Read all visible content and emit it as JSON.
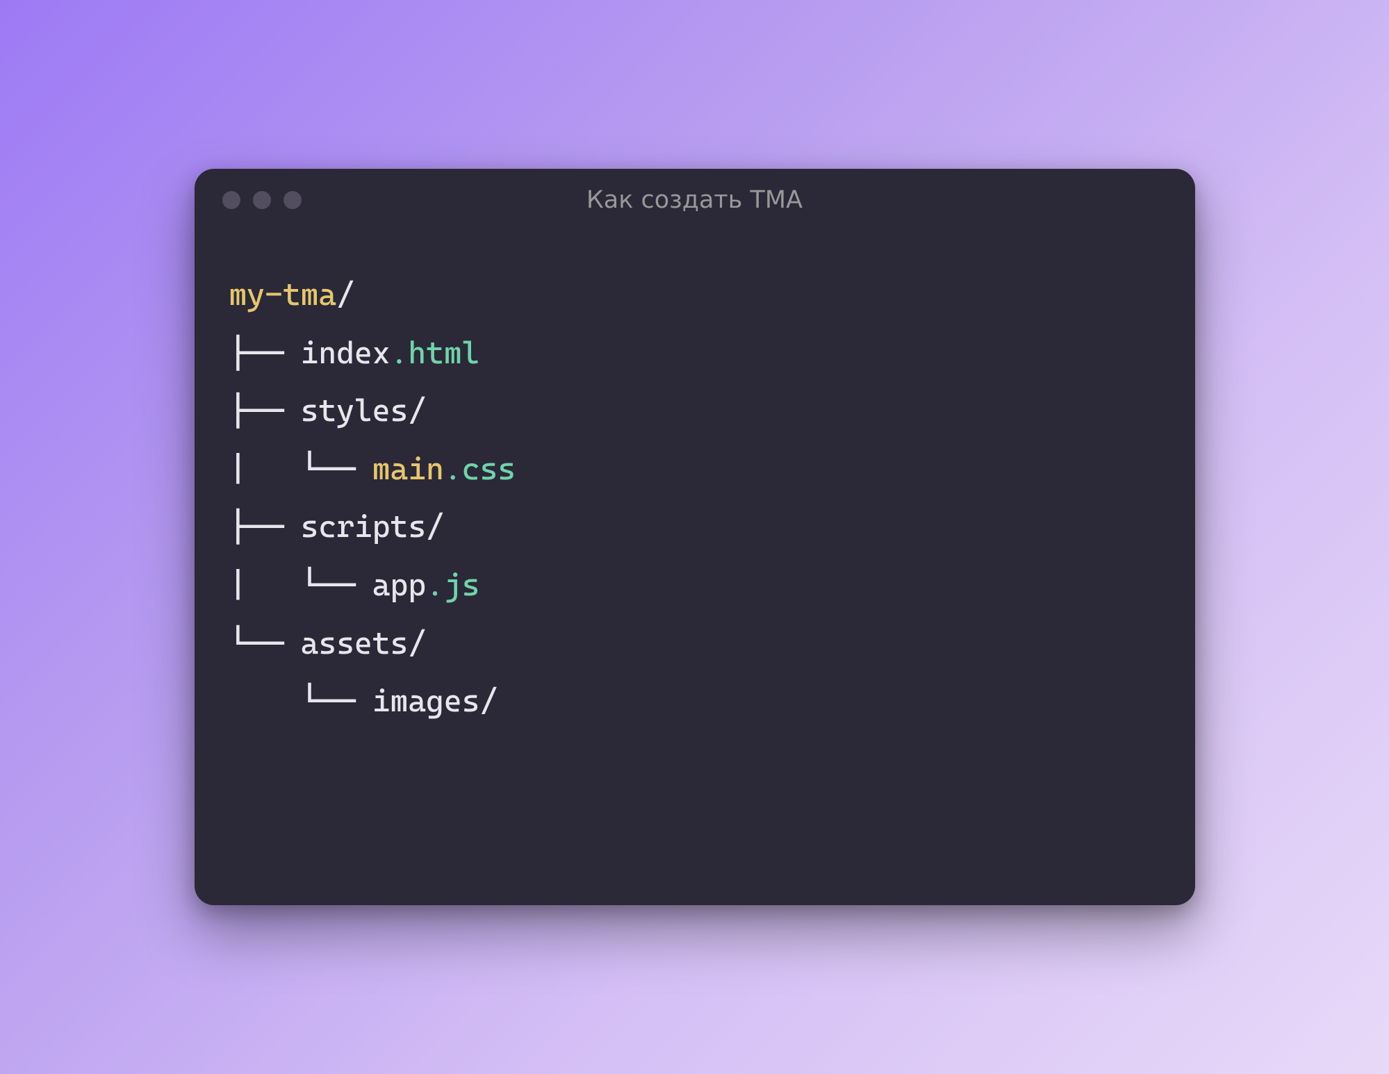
{
  "window": {
    "title": "Как создать TMA"
  },
  "tree": {
    "line1": {
      "name": "my-tma",
      "slash": "/"
    },
    "line2": {
      "branch": "├── ",
      "name": "index",
      "dot": ".",
      "ext": "html"
    },
    "line3": {
      "branch": "├── ",
      "name": "styles/"
    },
    "line4": {
      "pipe": "|   ",
      "branch": "└── ",
      "name": "main",
      "dot": ".",
      "ext": "css"
    },
    "line5": {
      "branch": "├── ",
      "name": "scripts/"
    },
    "line6": {
      "pipe": "|   ",
      "branch": "└── ",
      "name": "app",
      "dot": ".",
      "ext": "js"
    },
    "line7": {
      "branch": "└── ",
      "name": "assets/"
    },
    "line8": {
      "indent": "    ",
      "branch": "└── ",
      "name": "images/"
    }
  }
}
